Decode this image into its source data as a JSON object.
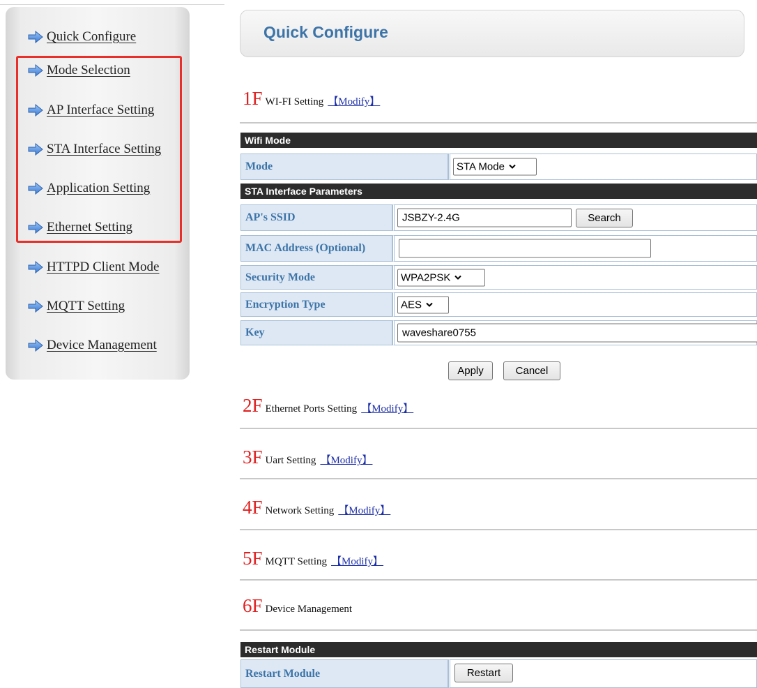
{
  "sidebar": {
    "items": [
      {
        "label": "Quick Configure",
        "icon": "arrow-right-icon"
      },
      {
        "label": "Mode Selection",
        "icon": "arrow-right-icon"
      },
      {
        "label": "AP Interface Setting",
        "icon": "arrow-right-icon"
      },
      {
        "label": "STA Interface Setting",
        "icon": "arrow-right-icon"
      },
      {
        "label": "Application Setting",
        "icon": "arrow-right-icon"
      },
      {
        "label": "Ethernet Setting",
        "icon": "arrow-right-icon"
      },
      {
        "label": "HTTPD Client Mode",
        "icon": "arrow-right-icon"
      },
      {
        "label": "MQTT Setting",
        "icon": "arrow-right-icon"
      },
      {
        "label": "Device Management",
        "icon": "arrow-right-icon"
      }
    ],
    "highlight_color": "#e8302a"
  },
  "header": {
    "title": "Quick Configure"
  },
  "floors": [
    {
      "num": "1F",
      "title": "WI-FI Setting",
      "modify": "【Modify】"
    },
    {
      "num": "2F",
      "title": "Ethernet Ports Setting",
      "modify": "【Modify】"
    },
    {
      "num": "3F",
      "title": "Uart Setting",
      "modify": "【Modify】"
    },
    {
      "num": "4F",
      "title": "Network Setting",
      "modify": "【Modify】"
    },
    {
      "num": "5F",
      "title": "MQTT Setting",
      "modify": "【Modify】"
    },
    {
      "num": "6F",
      "title": "Device Management",
      "modify": ""
    }
  ],
  "wifi": {
    "section_header": "Wifi Mode",
    "mode_label": "Mode",
    "mode_value": "STA Mode",
    "sta_header": "STA Interface Parameters",
    "ssid_label": "AP's SSID",
    "ssid_value": "JSBZY-2.4G",
    "search_button": "Search",
    "mac_label": "MAC Address (Optional)",
    "mac_value": "",
    "security_label": "Security Mode",
    "security_value": "WPA2PSK",
    "encryption_label": "Encryption Type",
    "encryption_value": "AES",
    "key_label": "Key",
    "key_value": "waveshare0755",
    "apply_button": "Apply",
    "cancel_button": "Cancel"
  },
  "restart": {
    "section_header": "Restart Module",
    "label": "Restart Module",
    "button": "Restart"
  },
  "colors": {
    "accent_blue": "#3d74a8",
    "floor_number_red": "#e02020",
    "link_blue": "#1c2fa8",
    "table_header_bg": "#2c2c2c",
    "label_cell_bg": "#dde8f4"
  }
}
